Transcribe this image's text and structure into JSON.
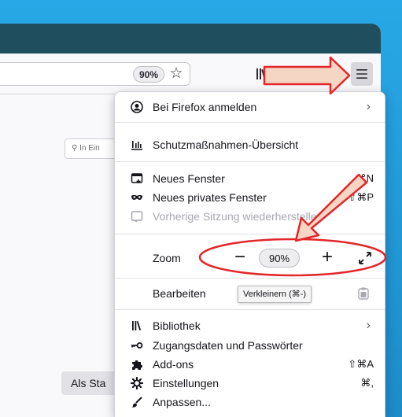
{
  "toolbar": {
    "zoom_badge": "90%",
    "bookmark_icon": "star-icon",
    "library_icon": "library-icon",
    "menu_icon": "hamburger-icon"
  },
  "page": {
    "search_placeholder": "In Ein",
    "default_button": "Als Sta"
  },
  "menu": {
    "sign_in": {
      "icon": "account-icon",
      "label": "Bei Firefox anmelden",
      "chevron": "›"
    },
    "protections": {
      "icon": "protections-icon",
      "label": "Schutzmaßnahmen-Übersicht"
    },
    "new_window": {
      "icon": "new-window-icon",
      "label": "Neues Fenster",
      "shortcut": "⌘N"
    },
    "private_window": {
      "icon": "private-mask-icon",
      "label": "Neues privates Fenster",
      "shortcut": "⇧⌘P"
    },
    "restore_session": {
      "icon": "restore-session-icon",
      "label": "Vorherige Sitzung wiederherstellen"
    },
    "zoom": {
      "label": "Zoom",
      "minus": "−",
      "value": "90%",
      "plus": "+",
      "fullscreen_icon": "fullscreen-icon"
    },
    "edit": {
      "label": "Bearbeiten",
      "tooltip": "Verkleinern (⌘-)",
      "paste_icon": "paste-icon"
    },
    "library": {
      "icon": "library-icon",
      "label": "Bibliothek",
      "chevron": "›"
    },
    "logins": {
      "icon": "key-icon",
      "label": "Zugangsdaten und Passwörter"
    },
    "addons": {
      "icon": "puzzle-icon",
      "label": "Add-ons",
      "shortcut": "⇧⌘A"
    },
    "settings": {
      "icon": "gear-icon",
      "label": "Einstellungen",
      "shortcut": "⌘,"
    },
    "customize": {
      "icon": "brush-icon",
      "label": "Anpassen..."
    }
  },
  "colors": {
    "titlebar": "#1f4f5e",
    "annotation_red": "#e3262a",
    "annotation_fill": "#f5d6c4"
  }
}
